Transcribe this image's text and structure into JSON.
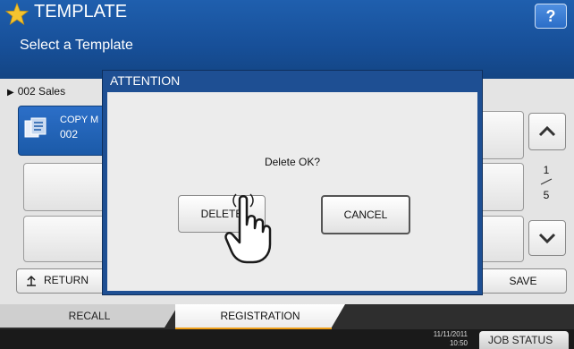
{
  "header": {
    "title": "TEMPLATE",
    "subtitle": "Select a Template",
    "help_label": "?"
  },
  "breadcrumb": {
    "label": "002 Sales"
  },
  "template_button": {
    "line1": "COPY M",
    "line2": "002"
  },
  "pager": {
    "current": "1",
    "total": "5"
  },
  "bottom": {
    "return_label": "RETURN",
    "save_label": "SAVE"
  },
  "tabs": {
    "recall": "RECALL",
    "registration": "REGISTRATION"
  },
  "status": {
    "date": "11/11/2011",
    "time": "10:50",
    "job_status": "JOB STATUS"
  },
  "dialog": {
    "title": "ATTENTION",
    "message": "Delete OK?",
    "delete_label": "DELETE",
    "cancel_label": "CANCEL"
  },
  "colors": {
    "header_blue": "#1f5fae",
    "dialog_blue": "#1e4f93",
    "tab_accent": "#f0a01a"
  },
  "icons": [
    "star-icon",
    "help-icon",
    "copy-template-icon",
    "chevron-up-icon",
    "chevron-down-icon",
    "return-icon",
    "pointer-hand-icon"
  ]
}
